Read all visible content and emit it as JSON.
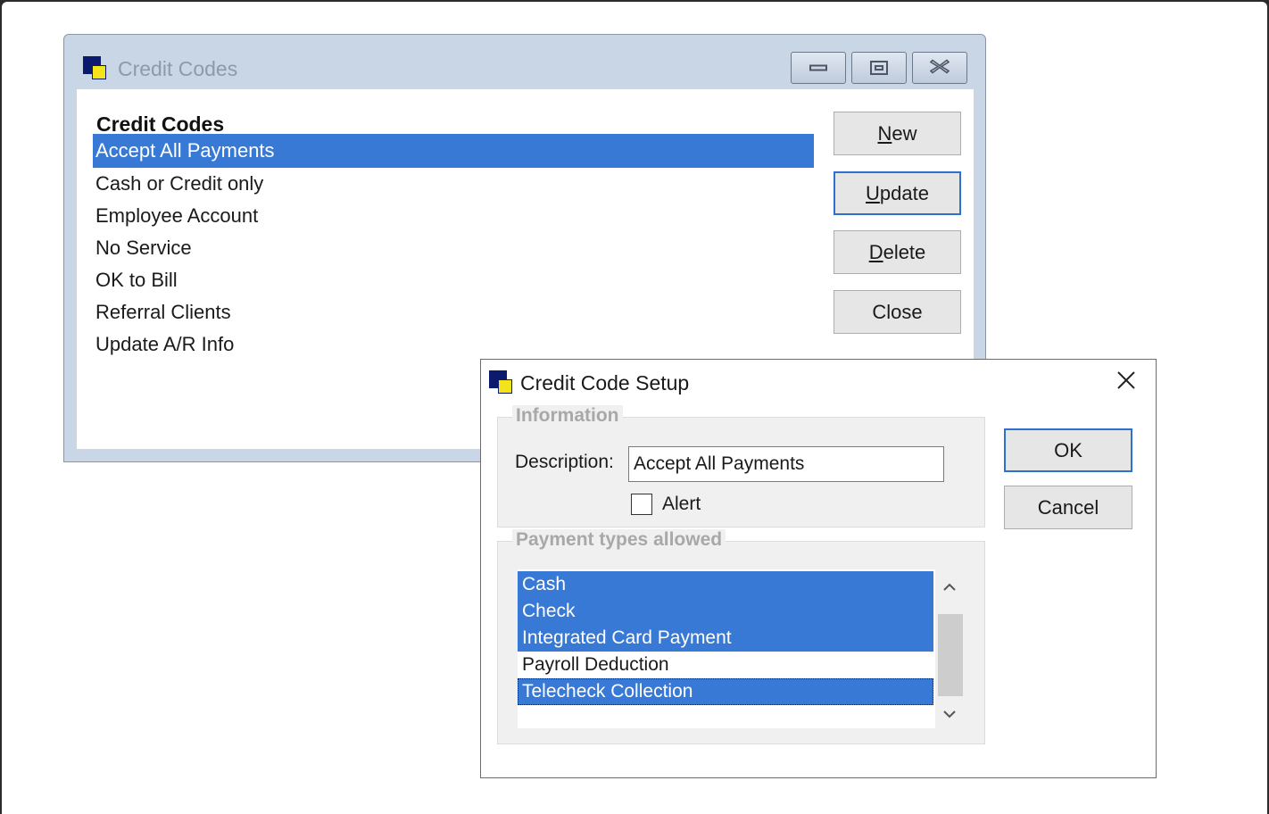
{
  "credit_codes_window": {
    "title": "Credit Codes",
    "list_header": "Credit Codes",
    "items": [
      {
        "label": "Accept All Payments",
        "selected": true
      },
      {
        "label": "Cash or Credit only",
        "selected": false
      },
      {
        "label": "Employee Account",
        "selected": false
      },
      {
        "label": "No Service",
        "selected": false
      },
      {
        "label": "OK to Bill",
        "selected": false
      },
      {
        "label": "Referral Clients",
        "selected": false
      },
      {
        "label": "Update A/R Info",
        "selected": false
      }
    ],
    "buttons": {
      "new": {
        "mnemonic": "N",
        "rest": "ew"
      },
      "update": {
        "mnemonic": "U",
        "rest": "pdate"
      },
      "delete": {
        "mnemonic": "D",
        "rest": "elete"
      },
      "close": "Close"
    },
    "caption_icons": [
      "minimize-icon",
      "maximize-icon",
      "close-icon"
    ]
  },
  "setup_dialog": {
    "title": "Credit Code Setup",
    "information_group": {
      "label": "Information",
      "description_label": "Description:",
      "description_value": "Accept All Payments",
      "alert_label": "Alert",
      "alert_checked": false
    },
    "payment_group": {
      "label": "Payment types allowed",
      "items": [
        {
          "label": "Cash",
          "selected": true
        },
        {
          "label": "Check",
          "selected": true
        },
        {
          "label": "Integrated Card Payment",
          "selected": true
        },
        {
          "label": "Payroll Deduction",
          "selected": false
        },
        {
          "label": "Telecheck Collection",
          "selected": true
        }
      ]
    },
    "ok_label": "OK",
    "cancel_label": "Cancel"
  },
  "colors": {
    "selection": "#3779d4",
    "focus_border": "#2e6fd0",
    "icon_blue": "#0c1a6e",
    "icon_yellow": "#f4e21b"
  }
}
